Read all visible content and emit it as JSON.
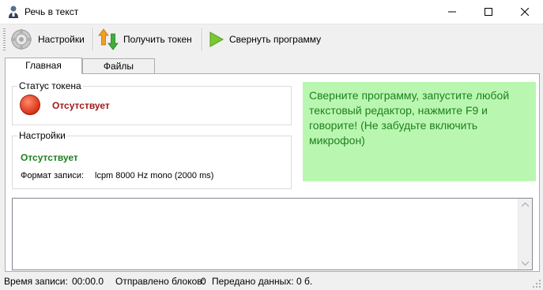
{
  "window": {
    "title": "Речь в текст",
    "minimize_icon": "minimize-icon",
    "maximize_icon": "maximize-icon",
    "close_icon": "close-icon"
  },
  "toolbar": {
    "settings_label": "Настройки",
    "get_token_label": "Получить токен",
    "minimize_app_label": "Свернуть программу"
  },
  "tabs": [
    {
      "label": "Главная",
      "active": true
    },
    {
      "label": "Файлы",
      "active": false
    }
  ],
  "token_status": {
    "title": "Статус токена",
    "value": "Отсутствует",
    "indicator_color": "#e0301e"
  },
  "settings": {
    "title": "Настройки",
    "status": "Отсутствует",
    "format_label": "Формат записи:",
    "format_value": "lcpm 8000 Hz mono (2000 ms)"
  },
  "hint": {
    "text": "Сверните программу, запустите любой текстовый редактор, нажмите F9 и говорите! (Не забудьте включить микрофон)"
  },
  "log": {
    "text": ""
  },
  "statusbar": {
    "record_time_label": "Время записи:",
    "record_time_value": "00:00.0",
    "blocks_sent_label": "Отправлено блоков:",
    "blocks_sent_value": "0",
    "data_sent_label": "Передано данных:",
    "data_sent_value": "0 б."
  },
  "colors": {
    "hint_bg": "#b9f7b0",
    "hint_text": "#1f7f1f",
    "token_status_text": "#a01818",
    "settings_status_text": "#1f7f1f"
  }
}
